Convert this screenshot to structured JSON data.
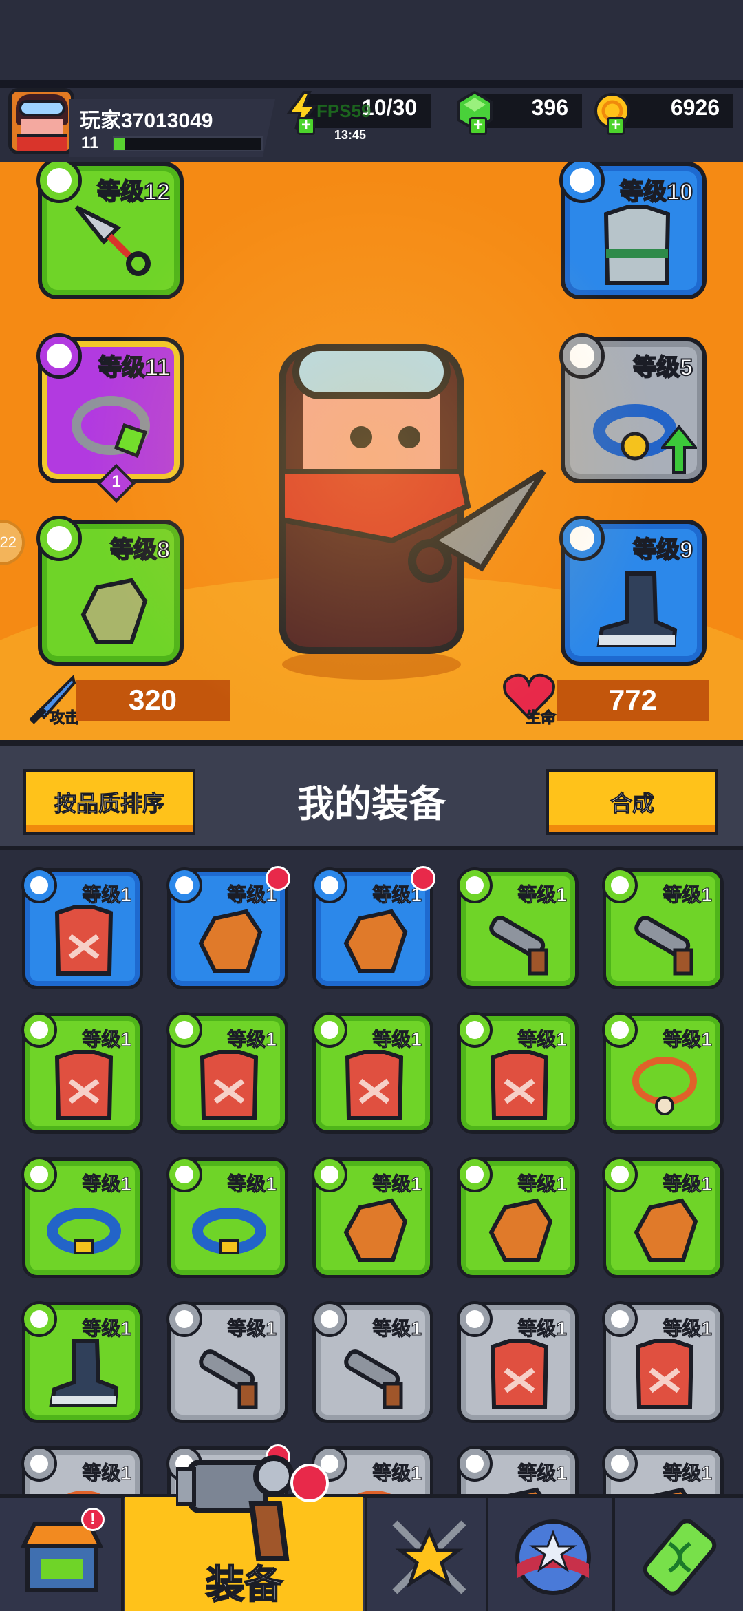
{
  "header": {
    "player_name": "玩家37013049",
    "level": "11",
    "xp_fraction": 0.07,
    "energy": "10/30",
    "energy_timer": "13:45",
    "fps_overlay": "FPS59",
    "gems": "396",
    "coins": "6926"
  },
  "hero": {
    "slots": {
      "weapon": {
        "level": "等级12",
        "rarity": "green",
        "icon": "weapon-icon"
      },
      "armor": {
        "level": "等级10",
        "rarity": "blue",
        "icon": "armor-icon"
      },
      "necklace": {
        "level": "等级11",
        "rarity": "purple",
        "icon": "necklace-icon",
        "star": "1"
      },
      "belt": {
        "level": "等级5",
        "rarity": "grey",
        "icon": "belt-icon"
      },
      "gloves": {
        "level": "等级8",
        "rarity": "green",
        "icon": "glove-icon"
      },
      "boots": {
        "level": "等级9",
        "rarity": "blue",
        "icon": "boot-icon"
      }
    },
    "side_chip": "22",
    "attack_label": "攻击",
    "attack_value": "320",
    "health_label": "生命",
    "health_value": "772"
  },
  "panel": {
    "sort_button": "按品质排序",
    "title": "我的装备",
    "merge_button": "合成"
  },
  "inventory": [
    {
      "level": "等级1",
      "rarity": "blue",
      "icon": "armor-icon",
      "new": false
    },
    {
      "level": "等级1",
      "rarity": "blue",
      "icon": "glove-icon",
      "new": true
    },
    {
      "level": "等级1",
      "rarity": "blue",
      "icon": "glove-icon",
      "new": true
    },
    {
      "level": "等级1",
      "rarity": "green",
      "icon": "weapon-icon",
      "new": false
    },
    {
      "level": "等级1",
      "rarity": "green",
      "icon": "weapon-icon",
      "new": false
    },
    {
      "level": "等级1",
      "rarity": "green",
      "icon": "armor-icon",
      "new": false
    },
    {
      "level": "等级1",
      "rarity": "green",
      "icon": "armor-icon",
      "new": false
    },
    {
      "level": "等级1",
      "rarity": "green",
      "icon": "armor-icon",
      "new": false
    },
    {
      "level": "等级1",
      "rarity": "green",
      "icon": "armor-icon",
      "new": false
    },
    {
      "level": "等级1",
      "rarity": "green",
      "icon": "necklace-icon",
      "new": false
    },
    {
      "level": "等级1",
      "rarity": "green",
      "icon": "belt-icon",
      "new": false
    },
    {
      "level": "等级1",
      "rarity": "green",
      "icon": "belt-icon",
      "new": false
    },
    {
      "level": "等级1",
      "rarity": "green",
      "icon": "glove-icon",
      "new": false
    },
    {
      "level": "等级1",
      "rarity": "green",
      "icon": "glove-icon",
      "new": false
    },
    {
      "level": "等级1",
      "rarity": "green",
      "icon": "glove-icon",
      "new": false
    },
    {
      "level": "等级1",
      "rarity": "green",
      "icon": "boot-icon",
      "new": false
    },
    {
      "level": "等级1",
      "rarity": "grey",
      "icon": "weapon-icon",
      "new": false
    },
    {
      "level": "等级1",
      "rarity": "grey",
      "icon": "weapon-icon",
      "new": false
    },
    {
      "level": "等级1",
      "rarity": "grey",
      "icon": "armor-icon",
      "new": false
    },
    {
      "level": "等级1",
      "rarity": "grey",
      "icon": "armor-icon",
      "new": false
    },
    {
      "level": "等级1",
      "rarity": "grey",
      "icon": "necklace-icon",
      "new": false
    },
    {
      "level": "等级1",
      "rarity": "grey",
      "icon": "necklace-icon",
      "new": true
    },
    {
      "level": "等级1",
      "rarity": "grey",
      "icon": "necklace-icon",
      "new": false
    },
    {
      "level": "等级1",
      "rarity": "grey",
      "icon": "glove-icon",
      "new": false
    },
    {
      "level": "等级1",
      "rarity": "grey",
      "icon": "glove-icon",
      "new": false
    }
  ],
  "nav": {
    "items": [
      {
        "name": "shop",
        "icon": "shop-icon",
        "alert": "!"
      },
      {
        "name": "equipment",
        "icon": "equipment-icon",
        "label": "装备",
        "active": true
      },
      {
        "name": "battle",
        "icon": "battle-icon"
      },
      {
        "name": "talent",
        "icon": "talent-icon"
      },
      {
        "name": "evolution",
        "icon": "dna-icon"
      }
    ]
  },
  "colors": {
    "green": "#6fd428",
    "blue": "#2c88ea",
    "purple": "#b23ae0",
    "grey": "#b8bdc6",
    "accent_yellow": "#ffc21a",
    "hero_orange": "#f58a14"
  }
}
